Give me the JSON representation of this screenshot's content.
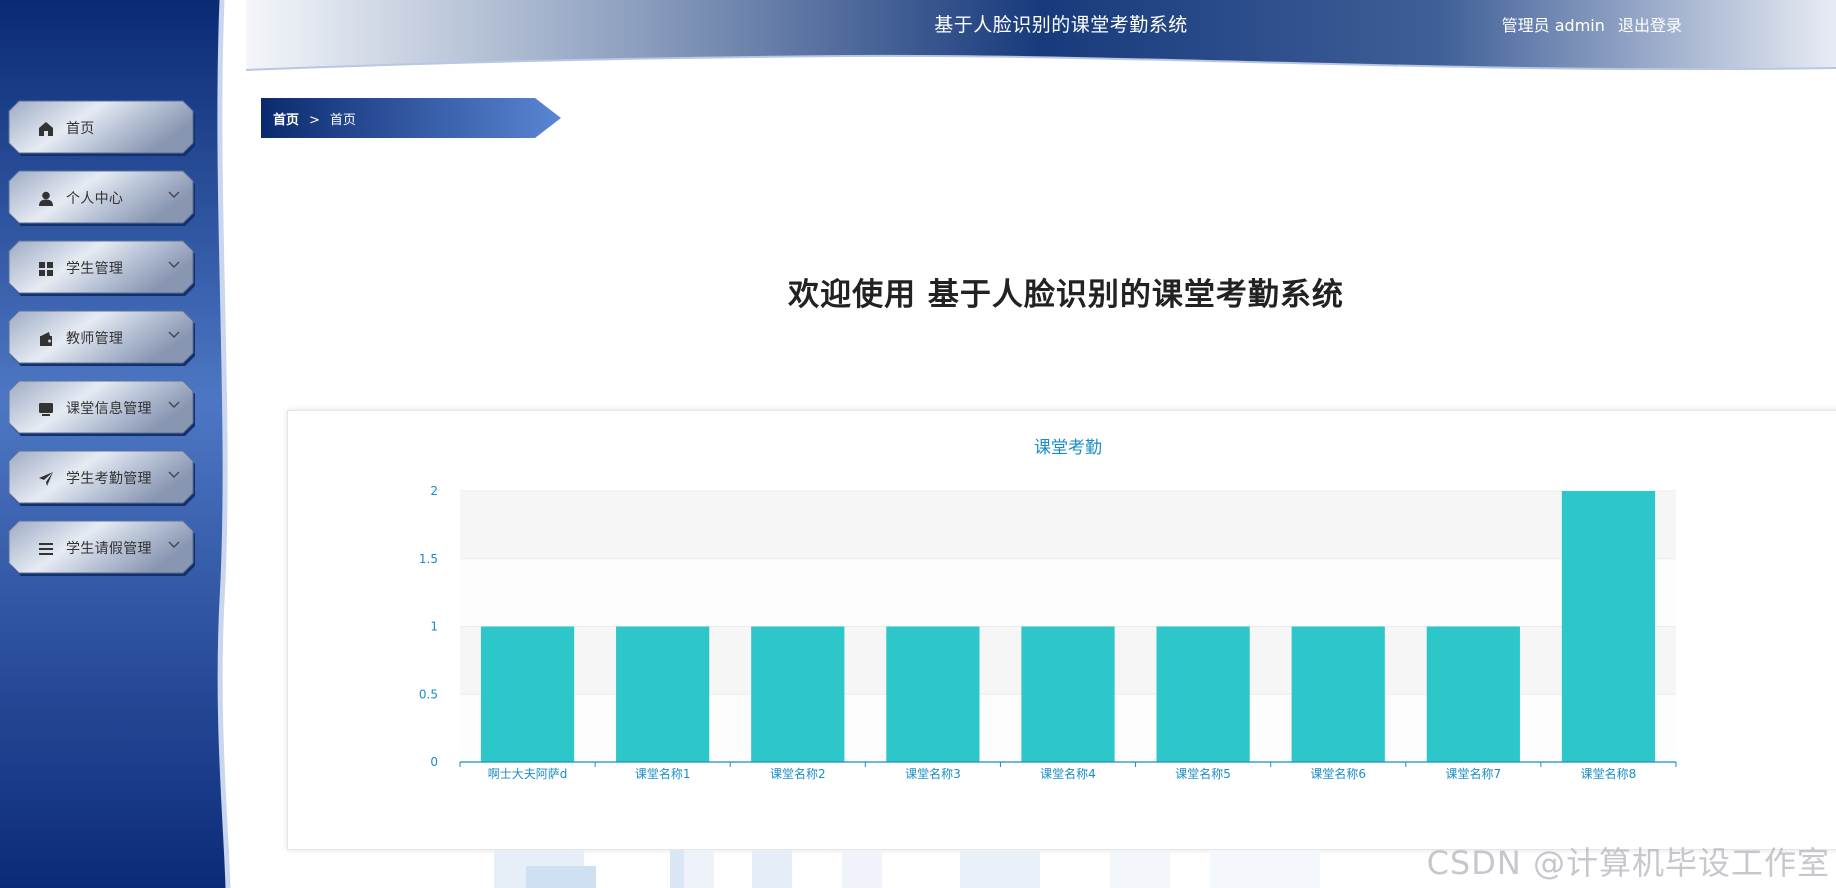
{
  "header": {
    "title": "基于人脸识别的课堂考勤系统",
    "user_label": "管理员 admin",
    "logout_label": "退出登录"
  },
  "sidebar": {
    "items": [
      {
        "label": "首页",
        "icon": "home-icon",
        "has_submenu": false
      },
      {
        "label": "个人中心",
        "icon": "person-icon",
        "has_submenu": true
      },
      {
        "label": "学生管理",
        "icon": "grid-icon",
        "has_submenu": true
      },
      {
        "label": "教师管理",
        "icon": "wallet-icon",
        "has_submenu": true
      },
      {
        "label": "课堂信息管理",
        "icon": "monitor-icon",
        "has_submenu": true
      },
      {
        "label": "学生考勤管理",
        "icon": "paper-plane-icon",
        "has_submenu": true
      },
      {
        "label": "学生请假管理",
        "icon": "list-icon",
        "has_submenu": true
      }
    ]
  },
  "breadcrumb": {
    "root": "首页",
    "separator": ">",
    "current": "首页"
  },
  "main": {
    "welcome": "欢迎使用 基于人脸识别的课堂考勤系统"
  },
  "chart_data": {
    "type": "bar",
    "title": "课堂考勤",
    "categories": [
      "啊士大夫阿萨d",
      "课堂名称1",
      "课堂名称2",
      "课堂名称3",
      "课堂名称4",
      "课堂名称5",
      "课堂名称6",
      "课堂名称7",
      "课堂名称8"
    ],
    "values": [
      1,
      1,
      1,
      1,
      1,
      1,
      1,
      1,
      2
    ],
    "ylim": [
      0,
      2
    ],
    "yticks": [
      "0",
      "0.5",
      "1",
      "1.5",
      "2"
    ],
    "bar_color": "#2ec7c9",
    "axis_color": "#1a8ec4",
    "xlabel": "",
    "ylabel": ""
  },
  "watermark": "CSDN @计算机毕设工作室",
  "colors": {
    "brand_dark": "#0b2a6e",
    "brand_mid": "#4a72b8",
    "accent": "#1a8ec4"
  }
}
